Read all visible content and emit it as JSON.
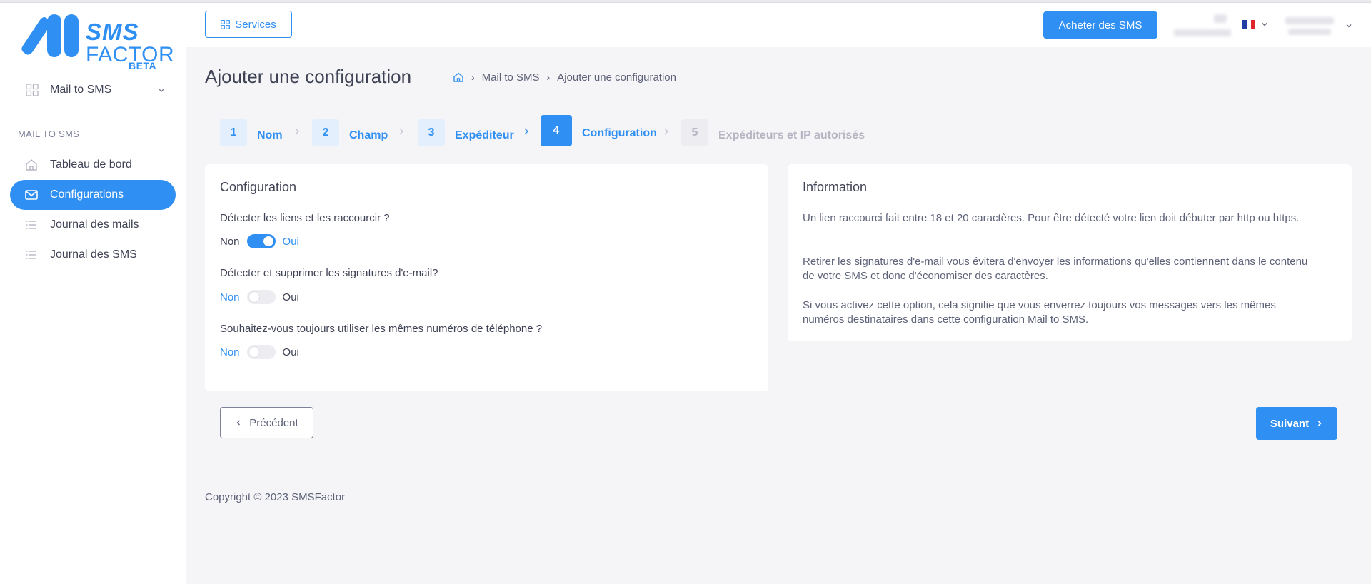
{
  "app": {
    "logo_sms": "SMS",
    "logo_factor": "FACTOR",
    "logo_beta": "BETA"
  },
  "sidebar": {
    "module_label": "Mail to SMS",
    "section_title": "MAIL TO SMS",
    "items": [
      {
        "label": "Tableau de bord",
        "icon": "home-icon",
        "active": false
      },
      {
        "label": "Configurations",
        "icon": "mail-icon",
        "active": true
      },
      {
        "label": "Journal des mails",
        "icon": "list-icon",
        "active": false
      },
      {
        "label": "Journal des SMS",
        "icon": "list-icon",
        "active": false
      }
    ]
  },
  "header": {
    "services_label": "Services",
    "buy_label": "Acheter des SMS",
    "language_flag": "fr-flag"
  },
  "page": {
    "title": "Ajouter une configuration",
    "breadcrumb": [
      "Mail to SMS",
      "Ajouter une configuration"
    ]
  },
  "stepper": {
    "steps": [
      {
        "num": "1",
        "label": "Nom",
        "state": "done"
      },
      {
        "num": "2",
        "label": "Champ",
        "state": "done"
      },
      {
        "num": "3",
        "label": "Expéditeur",
        "state": "done"
      },
      {
        "num": "4",
        "label": "Configuration",
        "state": "current"
      },
      {
        "num": "5",
        "label": "Expéditeurs et IP autorisés",
        "state": "disabled"
      }
    ]
  },
  "config_card": {
    "title": "Configuration",
    "questions": [
      {
        "label": "Détecter les liens et les raccourcir ?",
        "off": "Non",
        "on": "Oui",
        "value": true
      },
      {
        "label": "Détecter et supprimer les signatures d'e-mail?",
        "off": "Non",
        "on": "Oui",
        "value": false
      },
      {
        "label": "Souhaitez-vous toujours utiliser les mêmes numéros de téléphone ?",
        "off": "Non",
        "on": "Oui",
        "value": false
      }
    ]
  },
  "info_card": {
    "title": "Information",
    "paragraphs": [
      "Un lien raccourci fait entre 18 et 20 caractères. Pour être détecté votre lien doit débuter par http ou https.",
      "Retirer les signatures d'e-mail vous évitera d'envoyer les informations qu'elles contiennent dans le contenu de votre SMS et donc d'économiser des caractères.",
      "Si vous activez cette option, cela signifie que vous enverrez toujours vos messages vers les mêmes numéros destinataires dans cette configuration Mail to SMS."
    ]
  },
  "footer": {
    "prev_label": "Précédent",
    "next_label": "Suivant",
    "copyright": "Copyright © 2023 SMSFactor"
  },
  "colors": {
    "accent": "#2f8ff2",
    "background": "#f5f5f7",
    "card": "#ffffff",
    "text": "#3f4254",
    "disabled": "#b5b5c3"
  }
}
